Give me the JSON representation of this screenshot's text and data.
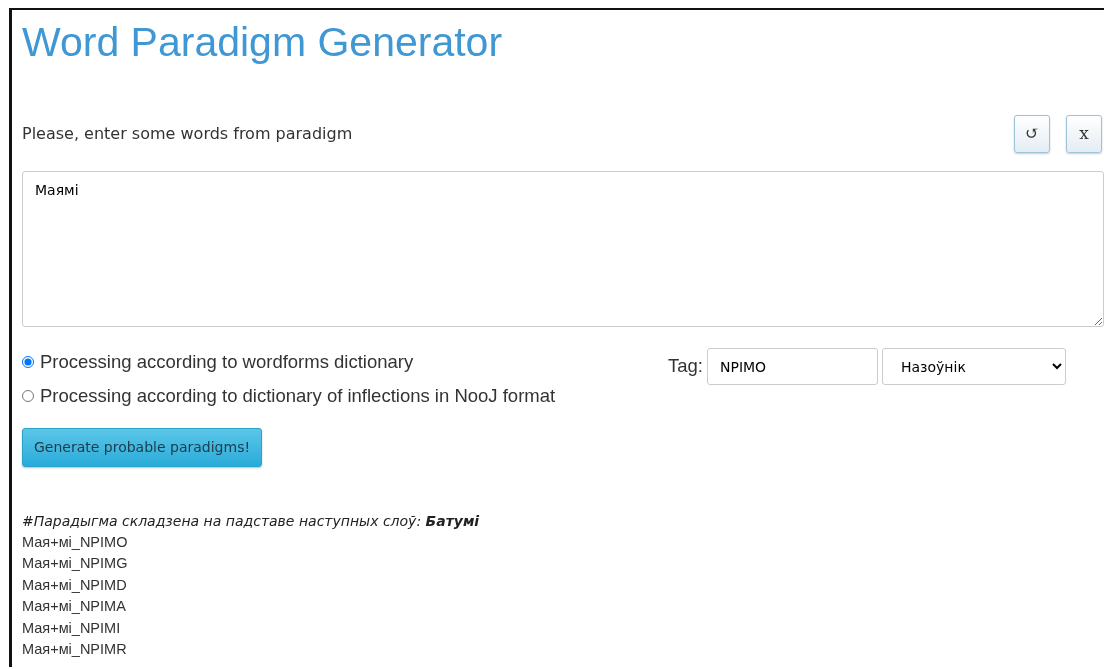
{
  "title": "Word Paradigm Generator",
  "prompt": "Please, enter some words from paradigm",
  "icon_buttons": [
    "↺",
    "x"
  ],
  "words_input": {
    "value": "Маямі"
  },
  "modes": [
    {
      "label": "Processing according to wordforms dictionary",
      "selected": true
    },
    {
      "label": "Processing according to dictionary of inflections in NooJ format",
      "selected": false
    }
  ],
  "tag": {
    "label": "Tag:",
    "value": "NPIMO",
    "pos_select": "Назоўнік"
  },
  "generate_button": "Generate probable paradigms!",
  "output": {
    "header": "#Парадыгма складзена на падставе наступных слоў: **Батумі**",
    "lines": [
      "Мая+мі_NPIMO",
      "Мая+мі_NPIMG",
      "Мая+мі_NPIMD",
      "Мая+мі_NPIMA",
      "Мая+мі_NPIMI",
      "Мая+мі_NPIMR"
    ]
  }
}
